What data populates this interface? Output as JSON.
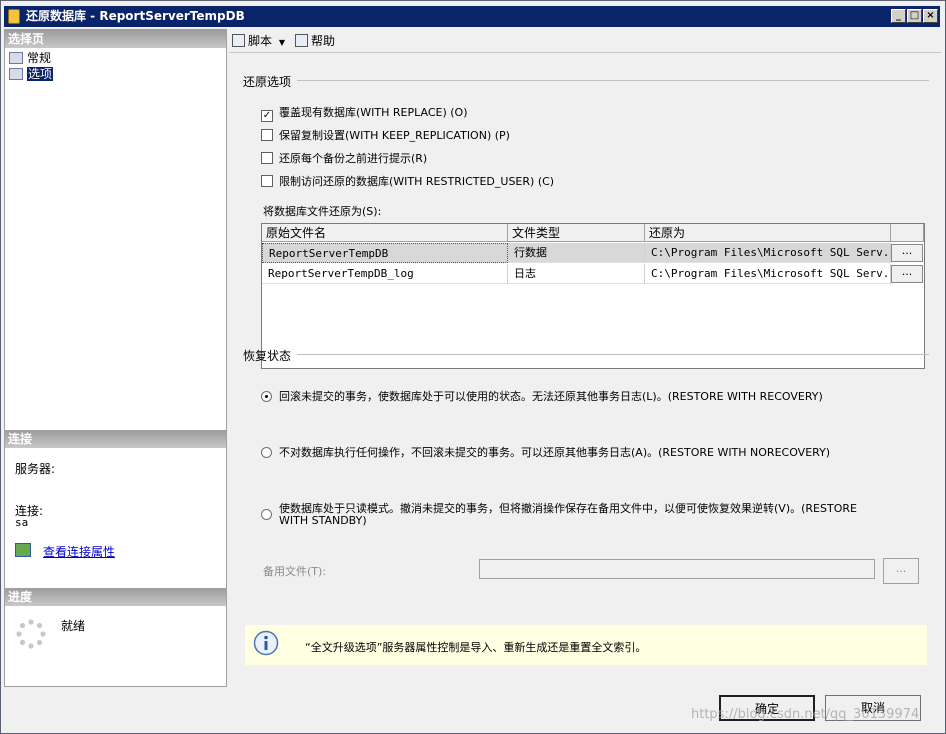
{
  "window": {
    "title": "还原数据库 - ReportServerTempDB",
    "controls": {
      "minimize": "_",
      "maximize": "□",
      "close": "×"
    }
  },
  "left_panel": {
    "select_page_header": "选择页",
    "nav_items": [
      {
        "label": "常规",
        "icon": "page-general-icon"
      },
      {
        "label": "选项",
        "icon": "page-options-icon",
        "selected": true
      }
    ],
    "connection_header": "连接",
    "server_label": "服务器:",
    "server_value": "",
    "connection_label": "连接:",
    "connection_value": "sa",
    "view_connection_link": "查看连接属性",
    "progress_header": "进度",
    "progress_status": "就绪"
  },
  "toolbar": {
    "script_label": "脚本",
    "help_label": "帮助"
  },
  "restore_options": {
    "section_title": "还原选项",
    "checkboxes": [
      {
        "label": "覆盖现有数据库(WITH REPLACE) (O)",
        "checked": true
      },
      {
        "label": "保留复制设置(WITH KEEP_REPLICATION) (P)",
        "checked": false
      },
      {
        "label": "还原每个备份之前进行提示(R)",
        "checked": false
      },
      {
        "label": "限制访问还原的数据库(WITH RESTRICTED_USER) (C)",
        "checked": false
      }
    ],
    "files_label": "将数据库文件还原为(S):",
    "grid_headers": [
      "原始文件名",
      "文件类型",
      "还原为"
    ],
    "grid_rows": [
      {
        "original": "ReportServerTempDB",
        "type": "行数据",
        "restore_as": "C:\\Program Files\\Microsoft SQL Serv...",
        "browse": "..."
      },
      {
        "original": "ReportServerTempDB_log",
        "type": "日志",
        "restore_as": "C:\\Program Files\\Microsoft SQL Serv...",
        "browse": "..."
      }
    ]
  },
  "recovery_state": {
    "section_title": "恢复状态",
    "options": [
      {
        "label": "回滚未提交的事务，使数据库处于可以使用的状态。无法还原其他事务日志(L)。(RESTORE WITH RECOVERY)",
        "selected": true
      },
      {
        "label": "不对数据库执行任何操作，不回滚未提交的事务。可以还原其他事务日志(A)。(RESTORE WITH NORECOVERY)",
        "selected": false
      },
      {
        "label_line1": "使数据库处于只读模式。撤消未提交的事务，但将撤消操作保存在备用文件中，以便可使恢复效果逆转(V)。(RESTORE",
        "label_line2": "WITH STANDBY)",
        "selected": false
      }
    ],
    "standby_file_label": "备用文件(T):",
    "standby_file_value": "",
    "standby_browse": "..."
  },
  "info_bar": {
    "text": "“全文升级选项”服务器属性控制是导入、重新生成还是重置全文索引。"
  },
  "buttons": {
    "ok": "确定",
    "cancel": "取消"
  },
  "watermark": "https://blog.csdn.net/qq_30139974",
  "colors": {
    "title_bar": "#0a246a",
    "selection": "#0a246a",
    "info_background": "#ffffe1",
    "link": "#0000cc"
  }
}
